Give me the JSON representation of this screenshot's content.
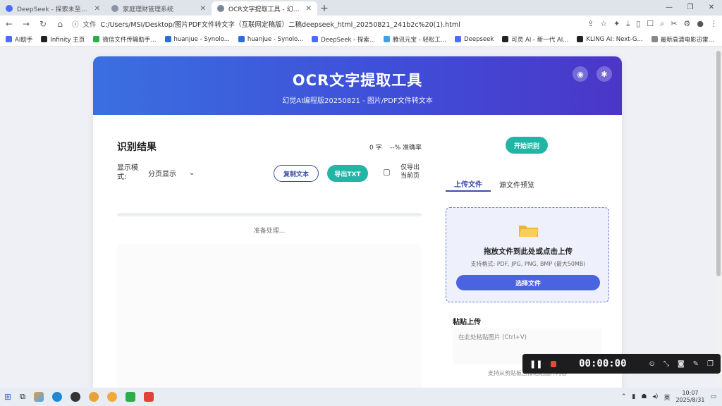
{
  "browser": {
    "tabs": [
      {
        "title": "DeepSeek - 探索未至之境",
        "active": false
      },
      {
        "title": "家庭理财管理系统",
        "active": false
      },
      {
        "title": "OCR文字提取工具 - 幻觉AI编程版",
        "active": true
      }
    ],
    "new_tab": "+",
    "window_controls": [
      "—",
      "❐",
      "✕"
    ],
    "address": {
      "file_label": "文件",
      "url": "C:/Users/MSI/Desktop/图片PDF文件转文字（互联网定稿版）二稿deepseek_html_20250821_241b2c%20(1).html"
    },
    "bookmarks": [
      "AI助手",
      "Infinity 主页",
      "微信文件传输助手...",
      "huanjue - Synolo...",
      "huanjue - Synolo...",
      "DeepSeek - 探索...",
      "腾讯元宝 - 轻松工...",
      "Deepseek",
      "可灵 AI - 新一代 AI...",
      "KLING AI: Next-G...",
      "最新高清电影迅雷..."
    ]
  },
  "hero": {
    "title": "OCR文字提取工具",
    "subtitle": "幻觉AI编程版20250821 - 图片/PDF文件转文本"
  },
  "results": {
    "title": "识别结果",
    "char_count": "0 字",
    "accuracy": "--% 准确率",
    "mode_label": "显示模式:",
    "mode_value": "分页显示",
    "copy_label": "复制文本",
    "export_label": "导出TXT",
    "only_current_label": "仅导出当前页",
    "status": "准备处理..."
  },
  "upload": {
    "start_label": "开始识别",
    "tab_upload": "上传文件",
    "tab_preview": "源文件预览",
    "drop_title": "拖放文件到此处或点击上传",
    "drop_hint": "支持格式: PDF, JPG, PNG, BMP (最大50MB)",
    "choose_label": "选择文件",
    "paste_title": "粘贴上传",
    "paste_placeholder": "在此处粘贴图片 (Ctrl+V)",
    "paste_note": "支持从剪贴板直接粘贴图片内容"
  },
  "recorder": {
    "time": "00:00:00"
  },
  "taskbar": {
    "ime": "英",
    "time": "10:07",
    "date": "2025/8/31"
  },
  "colors": {
    "hero_start": "#3b6fe0",
    "hero_end": "#4b36c8",
    "teal": "#22b5a6",
    "primary": "#4a63e0",
    "outline": "#3d4fa3"
  }
}
